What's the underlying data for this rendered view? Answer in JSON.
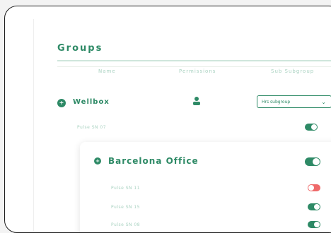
{
  "groups": {
    "title": "Groups",
    "columns": [
      "Name",
      "Permissions",
      "Sub Subgroup"
    ],
    "parent": {
      "name": "Wellbox",
      "icon": "user-icon",
      "subgroup_select": "Hrs subgroup",
      "item": {
        "label": "Pulse SN 07",
        "enabled": true
      }
    },
    "child": {
      "name": "Barcelona Office",
      "enabled": true,
      "items": [
        {
          "label": "Pulse SN 11",
          "enabled": false
        },
        {
          "label": "Pulse SN 15",
          "enabled": true
        },
        {
          "label": "Pulse SN 08",
          "enabled": true
        }
      ]
    }
  },
  "colors": {
    "accent": "#2e8a66",
    "danger": "#ef6a6a"
  }
}
